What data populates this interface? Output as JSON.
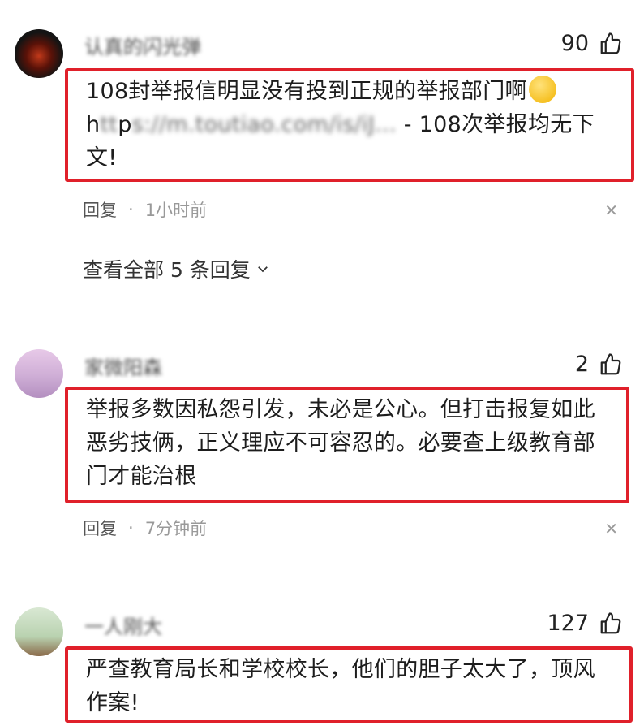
{
  "comments": [
    {
      "username": "认真的闪光弹",
      "likes": "90",
      "text_main": "108封举报信明显没有投到正规的举报部门啊",
      "link_a": "h",
      "link_b": "p",
      "link_c": "s://m.toutiao.com/is/iJ...",
      "text_tail": " - 108次举报均无下文!",
      "reply_label": "回复",
      "time": "1小时前",
      "view_all": "查看全部 5 条回复"
    },
    {
      "username": "家微阳森",
      "likes": "2",
      "text": "举报多数因私怨引发，未必是公心。但打击报复如此恶劣技俩，正义理应不可容忍的。必要查上级教育部门才能治根",
      "reply_label": "回复",
      "time": "7分钟前"
    },
    {
      "username": "一人刚大",
      "likes": "127",
      "text": "严查教育局长和学校校长，他们的胆子太大了，顶风作案!"
    }
  ],
  "icons": {
    "like": "thumbs-up-icon",
    "close": "close-icon",
    "chevron": "chevron-down-icon",
    "emoji": "smirk-emoji-icon"
  },
  "colors": {
    "highlight_border": "#e0202a"
  }
}
